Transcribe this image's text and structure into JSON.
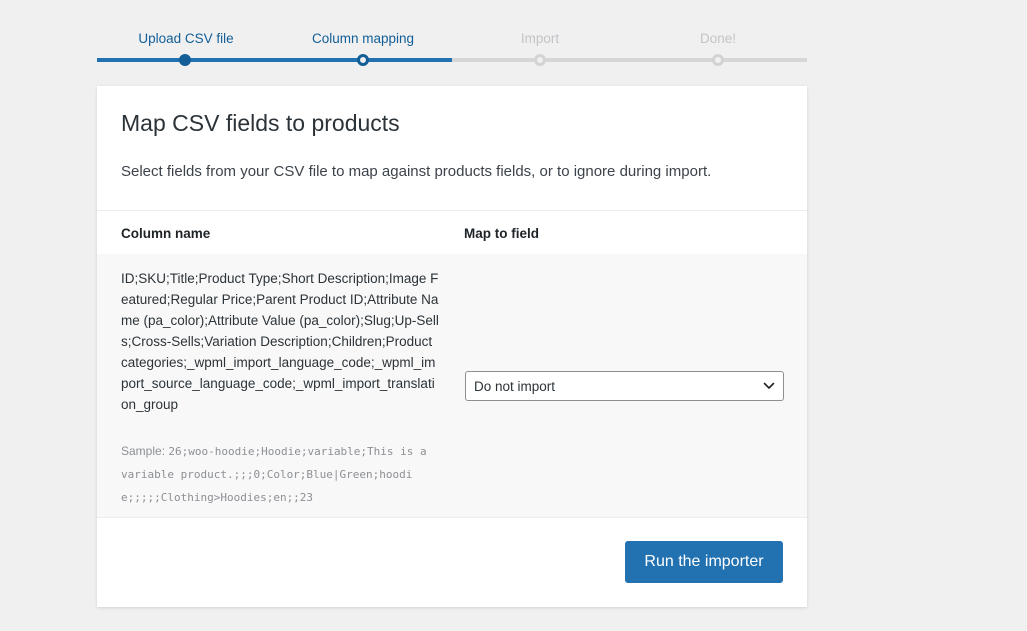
{
  "steps": [
    {
      "label": "Upload CSV file",
      "state": "done"
    },
    {
      "label": "Column mapping",
      "state": "active"
    },
    {
      "label": "Import",
      "state": "pending"
    },
    {
      "label": "Done!",
      "state": "pending"
    }
  ],
  "card": {
    "title": "Map CSV fields to products",
    "description": "Select fields from your CSV file to map against products fields, or to ignore during import."
  },
  "table": {
    "headers": {
      "column_name": "Column name",
      "map_to_field": "Map to field"
    },
    "rows": [
      {
        "column_name": "ID;SKU;Title;Product Type;Short Description;Image Featured;Regular Price;Parent Product ID;Attribute Name (pa_color);Attribute Value (pa_color);Slug;Up-Sells;Cross-Sells;Variation Description;Children;Product categories;_wpml_import_language_code;_wpml_import_source_language_code;_wpml_import_translation_group",
        "sample_label": "Sample:",
        "sample_value": "26;woo-hoodie;Hoodie;variable;This is a variable product.;;;0;Color;Blue|Green;hoodie;;;;;Clothing>Hoodies;en;;23",
        "mapping": "Do not import"
      }
    ]
  },
  "actions": {
    "run_label": "Run the importer"
  },
  "colors": {
    "accent": "#2271b1",
    "accent_dark": "#135e96",
    "pending": "#c3c4c7",
    "background": "#f0f0f1"
  }
}
